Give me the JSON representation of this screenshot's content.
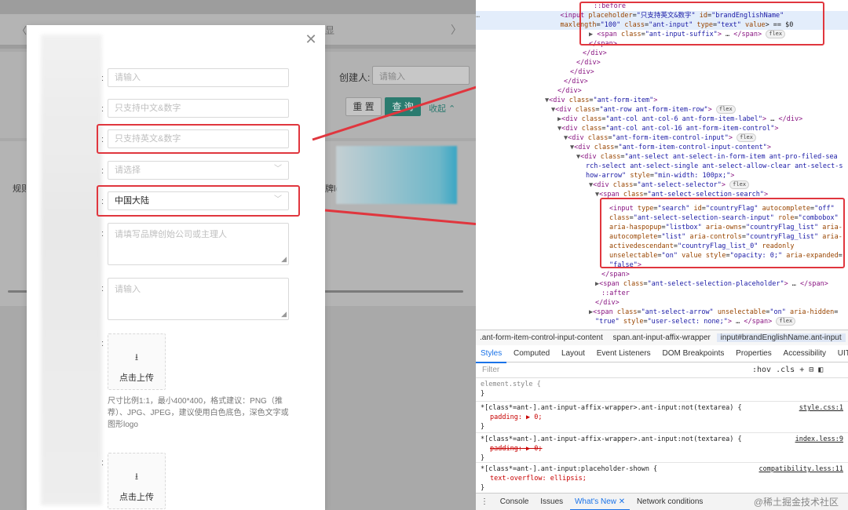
{
  "background_app": {
    "tab_prefix": "〈  心",
    "tab_suffix": "显",
    "tab_next": "〉",
    "creator_label": "创建人:",
    "creator_placeholder": "请输入",
    "reset_label": "重 置",
    "query_label": "查 询",
    "collapse_label": "收起 ⌃",
    "side_text": "规则",
    "logo_text": "牌logo"
  },
  "modal": {
    "close_glyph": "✕",
    "fields": [
      {
        "placeholder": "请输入"
      },
      {
        "placeholder": "只支持中文&数字"
      },
      {
        "placeholder": "只支持英文&数字"
      },
      {
        "placeholder": "请选择"
      },
      {
        "value": "中国大陆"
      }
    ],
    "textareas": [
      {
        "placeholder": "请填写品牌创始公司或主理人"
      },
      {
        "placeholder": "请输入"
      }
    ],
    "upload_label": "点击上传",
    "upload_icon": "⭳",
    "upload_hint": "尺寸比例1:1，最小400*400，格式建议：PNG（推荐）、JPG、JPEG，建议使用白色底色，深色文字或图形logo"
  },
  "devtools": {
    "crumbs": [
      ".ant-form-item-control-input-content",
      "span.ant-input-affix-wrapper",
      "input#brandEnglishName.ant-input"
    ],
    "tabs": [
      "Styles",
      "Computed",
      "Layout",
      "Event Listeners",
      "DOM Breakpoints",
      "Properties",
      "Accessibility",
      "UITest"
    ],
    "active_tab": "Styles",
    "filter_placeholder": "Filter",
    "filter_tools": ":hov .cls + ⊟ ◧",
    "drawer_tabs": [
      "Console",
      "Issues",
      "What's New ✕",
      "Network conditions"
    ],
    "watermark": "@稀土掘金技术社区",
    "styles": [
      {
        "selector": "element.style {",
        "props": [],
        "source": ""
      },
      {
        "selector": "*[class*=ant-].ant-input-affix-wrapper>.ant-input:not(textarea) {",
        "props": [
          "padding: ▶ 0;"
        ],
        "source": "style.css:1"
      },
      {
        "selector": "*[class*=ant-].ant-input-affix-wrapper>.ant-input:not(textarea) {",
        "props": [
          "padding: ▶ 0;"
        ],
        "source": "index.less:9",
        "strike": true
      },
      {
        "selector": "*[class*=ant-].ant-input:placeholder-shown {",
        "props": [
          "text-overflow: ellipsis;"
        ],
        "source": "compatibility.less:11"
      }
    ]
  },
  "colors": {
    "highlight": "#e0363e",
    "primary_bg_btn": "#2a7b6f",
    "devtools_accent": "#1a73e8"
  }
}
